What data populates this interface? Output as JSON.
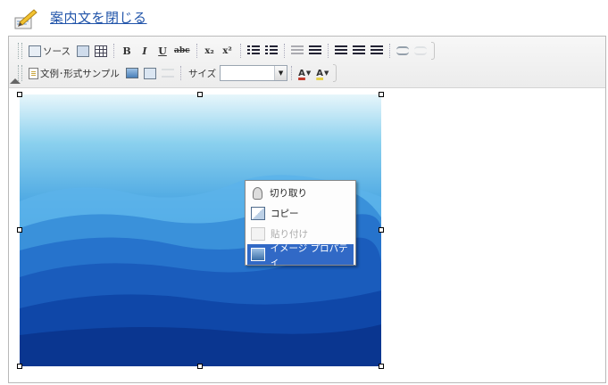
{
  "header": {
    "close_link": "案内文を閉じる",
    "icon": "memo-pencil-icon"
  },
  "toolbar": {
    "row1": {
      "source_label": "ソース",
      "buttons": [
        {
          "name": "source-button",
          "icon": "source-icon"
        },
        {
          "name": "preview-button",
          "icon": "preview-icon"
        },
        {
          "name": "table-button",
          "icon": "table-icon"
        },
        {
          "name": "bold-button",
          "glyph": "B"
        },
        {
          "name": "italic-button",
          "glyph": "I"
        },
        {
          "name": "underline-button",
          "glyph": "U"
        },
        {
          "name": "strikethrough-button",
          "glyph": "abc"
        },
        {
          "name": "subscript-button",
          "glyph": "x₂"
        },
        {
          "name": "superscript-button",
          "glyph": "x²"
        },
        {
          "name": "numbered-list-button",
          "icon": "numbered-list-icon"
        },
        {
          "name": "bulleted-list-button",
          "icon": "bulleted-list-icon"
        },
        {
          "name": "outdent-button",
          "icon": "outdent-icon",
          "disabled": true
        },
        {
          "name": "indent-button",
          "icon": "indent-icon"
        },
        {
          "name": "align-left-button",
          "icon": "align-left-icon"
        },
        {
          "name": "align-center-button",
          "icon": "align-center-icon"
        },
        {
          "name": "align-right-button",
          "icon": "align-right-icon"
        },
        {
          "name": "link-button",
          "icon": "link-icon"
        },
        {
          "name": "unlink-button",
          "icon": "unlink-icon",
          "disabled": true
        }
      ]
    },
    "row2": {
      "template_label": "文例･形式サンプル",
      "size_label": "サイズ",
      "size_value": "",
      "font_color_glyph": "A",
      "bg_color_glyph": "A"
    }
  },
  "image": {
    "description_icon": "mountain-landscape-image"
  },
  "context_menu": {
    "items": [
      {
        "label": "切り取り",
        "icon": "cut-icon",
        "disabled": false,
        "selected": false
      },
      {
        "label": "コピー",
        "icon": "copy-icon",
        "disabled": false,
        "selected": false
      },
      {
        "label": "貼り付け",
        "icon": "paste-icon",
        "disabled": true,
        "selected": false
      },
      {
        "label": "イメージ プロパティ",
        "icon": "image-properties-icon",
        "disabled": false,
        "selected": true
      }
    ]
  },
  "colors": {
    "link": "#2255aa",
    "menu_highlight": "#3169c6",
    "toolbar_bg": "#ececec"
  }
}
